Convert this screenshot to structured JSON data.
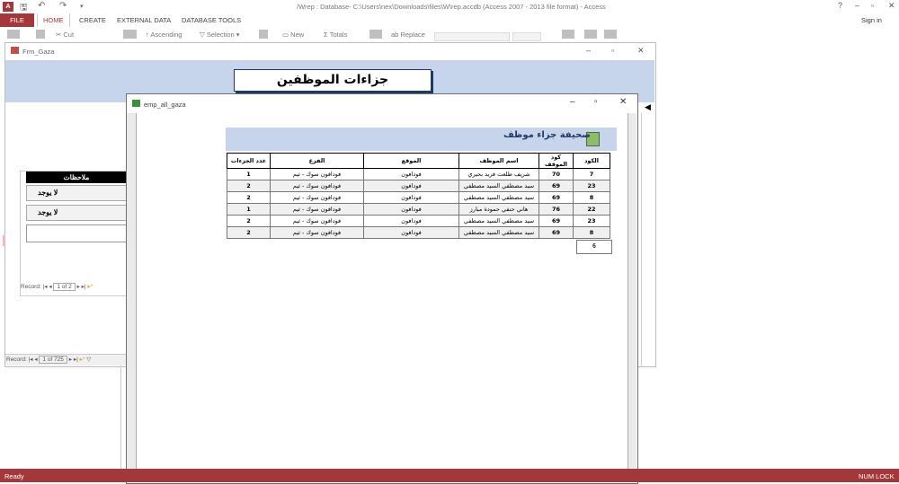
{
  "app": {
    "window_title": "/Wrep : Database- C:\\Users\\nex\\Downloads\\files\\W\\rep.accdb (Access 2007 - 2013 file format) - Access",
    "icon_label": "A",
    "signin": "Sign in",
    "window_controls": [
      "?",
      "–",
      "▫",
      "✕"
    ]
  },
  "ribbon": {
    "tabs": [
      "FILE",
      "HOME",
      "CREATE",
      "EXTERNAL DATA",
      "DATABASE TOOLS"
    ],
    "commands": [
      "Cut",
      "Ascending",
      "Selection ▾",
      "New",
      "Totals",
      "Replace"
    ]
  },
  "frm_gaza": {
    "title": "Frm_Gaza",
    "heading": "جزاءات الموظفين",
    "subform_header": "ملاحظات",
    "subform_rows": [
      "لا يوجد",
      "لا يوجد"
    ],
    "subform_nav": {
      "label": "Record:",
      "value": "1 of 2"
    },
    "main_nav": {
      "label": "Record:",
      "value": "1 of 725"
    }
  },
  "emp_all_gaza": {
    "title": "emp_all_gaza",
    "report_title": "صحيفة جزاء موظف",
    "columns": [
      "الكود",
      "كود الموقف",
      "اسم الموظف",
      "الموقع",
      "الفرع",
      "عدد الجزءات"
    ],
    "rows": [
      [
        "7",
        "70",
        "شريف طلعت فريد بحيري",
        "فودافون",
        "فودافون سوك - ثيم",
        "1"
      ],
      [
        "23",
        "69",
        "سيد مصطفي السيد مصطفي",
        "فودافون",
        "فودافون سوك - ثيم",
        "2"
      ],
      [
        "8",
        "69",
        "سيد مصطفي السيد مصطفي",
        "فودافون",
        "فودافون سوك - ثيم",
        "2"
      ],
      [
        "22",
        "76",
        "هاني حنفي حمودة مبارز",
        "فودافون",
        "فودافون سوك - ثيم",
        "1"
      ],
      [
        "23",
        "69",
        "سيد مصطفي السيد مصطفي",
        "فودافون",
        "فودافون سوك - ثيم",
        "2"
      ],
      [
        "8",
        "69",
        "سيد مصطفي السيد مصطفي",
        "فودافون",
        "فودافون سوك - ثيم",
        "2"
      ]
    ],
    "count": "6"
  },
  "status": {
    "left": "Ready",
    "right": "NUM LOCK"
  },
  "colors": {
    "accent": "#a4373a",
    "header_blue": "#c6d5ec",
    "title_navy": "#1f3a64"
  }
}
